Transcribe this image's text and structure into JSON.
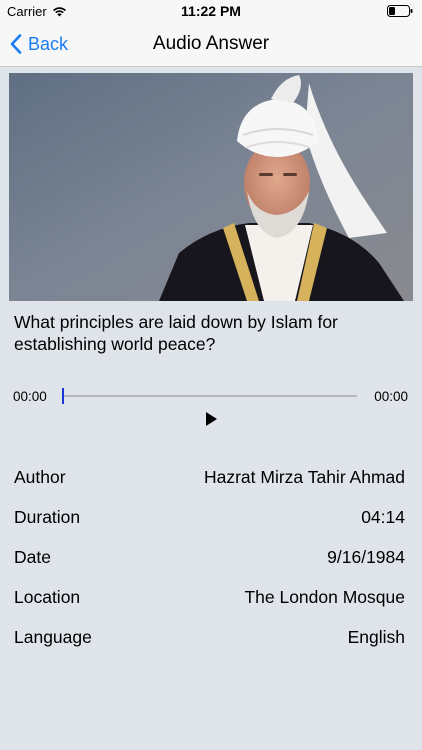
{
  "status_bar": {
    "carrier": "Carrier",
    "time": "11:22 PM",
    "icons": [
      "wifi-icon",
      "battery-icon"
    ]
  },
  "nav": {
    "back_label": "Back",
    "title": "Audio Answer",
    "accent_color": "#1a7cf5"
  },
  "question": "What principles are laid down by Islam for establishing world peace?",
  "player": {
    "current_time": "00:00",
    "total_time": "00:00",
    "progress": 0,
    "play_icon": "play-icon"
  },
  "details": [
    {
      "label": "Author",
      "value": "Hazrat Mirza Tahir Ahmad"
    },
    {
      "label": "Duration",
      "value": "04:14"
    },
    {
      "label": "Date",
      "value": "9/16/1984"
    },
    {
      "label": "Location",
      "value": "The London Mosque"
    },
    {
      "label": "Language",
      "value": "English"
    }
  ]
}
